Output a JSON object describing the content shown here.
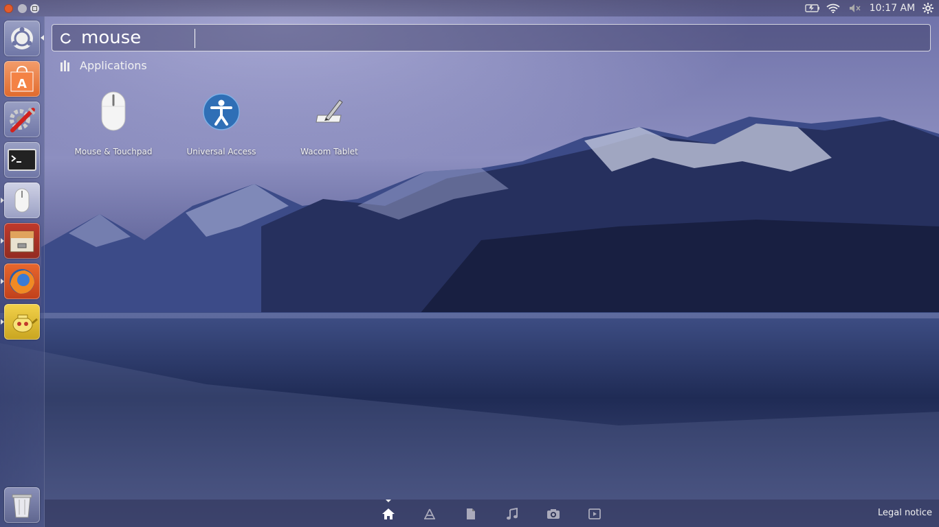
{
  "top_panel": {
    "clock": "10:17 AM",
    "icons": [
      "battery-icon",
      "wifi-icon",
      "volume-muted-icon",
      "gear-icon"
    ]
  },
  "launcher": {
    "items": [
      {
        "name": "dash-home",
        "icon": "ubuntu-logo-icon"
      },
      {
        "name": "software-center",
        "icon": "shopping-bag-icon"
      },
      {
        "name": "system-settings",
        "icon": "settings-tools-icon"
      },
      {
        "name": "terminal",
        "icon": "terminal-icon"
      },
      {
        "name": "mouse-touchpad",
        "icon": "mouse-icon",
        "running": true
      },
      {
        "name": "file-manager",
        "icon": "file-cabinet-icon",
        "running": true
      },
      {
        "name": "firefox",
        "icon": "firefox-icon",
        "running": true
      },
      {
        "name": "teapot-app",
        "icon": "teapot-icon",
        "running": true
      },
      {
        "name": "trash",
        "icon": "trash-icon"
      }
    ]
  },
  "search": {
    "query": "mouse"
  },
  "results": {
    "category": "Applications",
    "items": [
      {
        "label": "Mouse & Touchpad",
        "icon": "mouse-icon"
      },
      {
        "label": "Universal Access",
        "icon": "accessibility-icon"
      },
      {
        "label": "Wacom Tablet",
        "icon": "tablet-pen-icon"
      }
    ]
  },
  "lens_bar": {
    "lenses": [
      "home-icon",
      "applications-icon",
      "files-icon",
      "music-icon",
      "photos-icon",
      "video-icon"
    ],
    "active": "home-icon",
    "legal_notice": "Legal notice"
  }
}
